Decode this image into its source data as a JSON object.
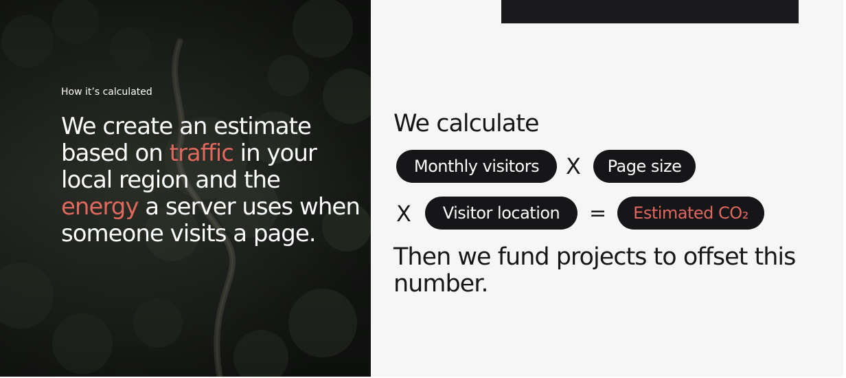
{
  "left": {
    "eyebrow": "How it’s calculated",
    "headline": {
      "part1": "We create an estimate based on ",
      "accent1": "traffic",
      "part2": " in your local region and the ",
      "accent2": "energy",
      "part3": " a server uses when someone visits a page."
    }
  },
  "right": {
    "title": "We calculate",
    "formula": {
      "monthly_visitors": "Monthly visitors",
      "times_1": "X",
      "page_size": "Page size",
      "times_2": "X",
      "visitor_location": "Visitor location",
      "equals": "=",
      "result": "Estimated CO₂"
    },
    "outro": "Then we fund projects to offset this number."
  },
  "colors": {
    "accent": "#e0685f",
    "dark": "#161619",
    "light_bg": "#f6f6f6",
    "photo_bg": "#1b1d1b"
  }
}
